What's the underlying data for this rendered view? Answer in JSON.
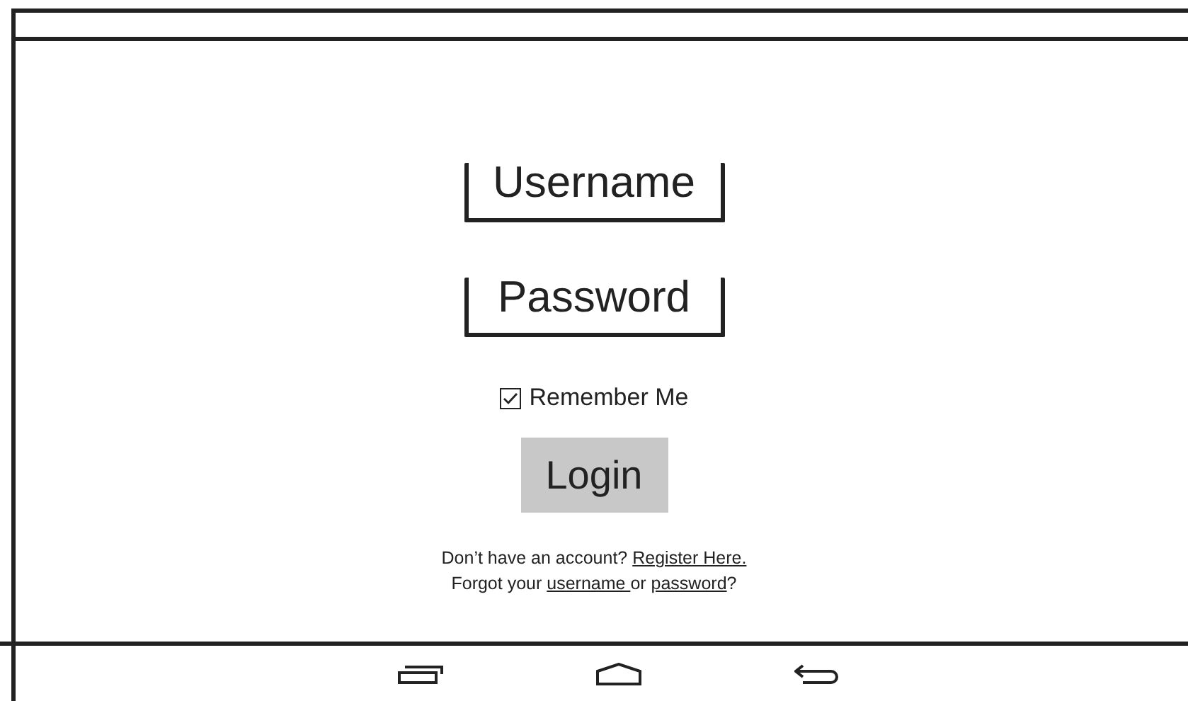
{
  "fields": [
    {
      "placeholder": "Username"
    },
    {
      "placeholder": "Password"
    }
  ],
  "remember": {
    "label": "Remember Me",
    "checked": true
  },
  "login_button": "Login",
  "register_line": {
    "prompt": "Don’t have an account?",
    "link": "Register Here."
  },
  "forgot_line": {
    "before": "Forgot your",
    "link1": "username",
    "middle": "or",
    "link2": "password",
    "after": "?"
  }
}
